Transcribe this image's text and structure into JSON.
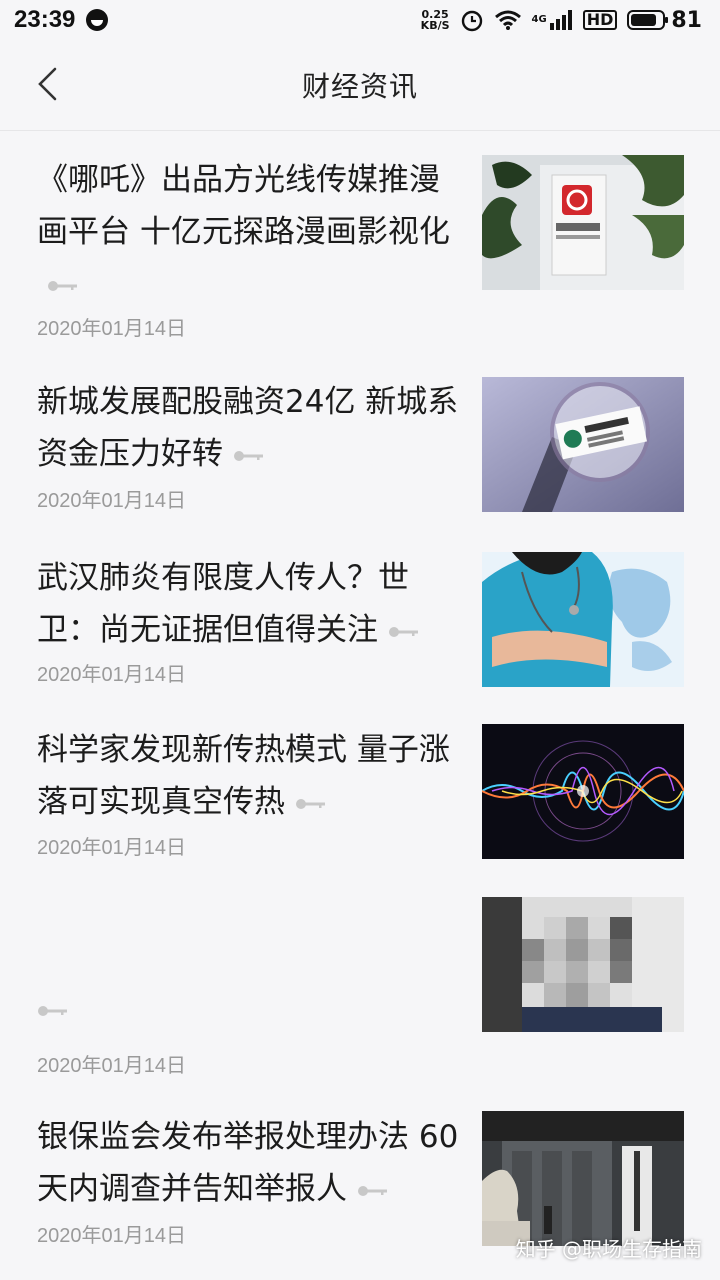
{
  "status_bar": {
    "time": "23:39",
    "net_speed_value": "0.25",
    "net_speed_unit": "KB/S",
    "network_type": "4G",
    "hd_label": "HD",
    "battery_level": "81",
    "battery_fraction": 0.81
  },
  "nav": {
    "title": "财经资讯",
    "back_icon": "chevron-left-icon"
  },
  "news": [
    {
      "title": "《哪吒》出品方光线传媒推漫画平台 十亿元探路漫画影视化",
      "date": "2020年01月14日",
      "image": "光线传媒 building photo"
    },
    {
      "title": "新城发展配股融资24亿 新城系资金压力好转",
      "date": "2020年01月14日",
      "image": "新城控股 card under magnifier"
    },
    {
      "title": "武汉肺炎有限度人传人？世卫：尚无证据但值得关注",
      "date": "2020年01月14日",
      "image": "nurse with stethoscope"
    },
    {
      "title": "科学家发现新传热模式 量子涨落可实现真空传热",
      "date": "2020年01月14日",
      "image": "colorful wave graphic"
    },
    {
      "title": "",
      "date": "2020年01月14日",
      "image": "pixelated portrait"
    },
    {
      "title": "银保监会发布举报处理办法 60天内调查并告知举报人",
      "date": "2020年01月14日",
      "image": "regulator building with lion statue"
    }
  ],
  "watermark": "知乎 @职场生存指南",
  "colors": {
    "background": "#f6f6f8",
    "text": "#1c1c1c",
    "date": "#9a9a9a"
  }
}
